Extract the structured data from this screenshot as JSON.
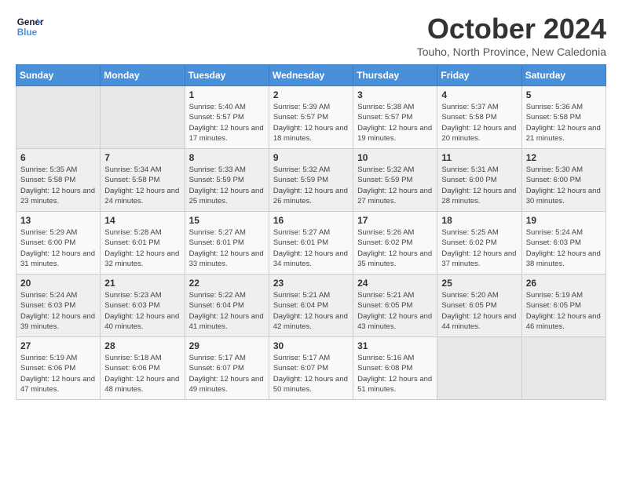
{
  "logo": {
    "line1": "General",
    "line2": "Blue"
  },
  "title": "October 2024",
  "subtitle": "Touho, North Province, New Caledonia",
  "days_header": [
    "Sunday",
    "Monday",
    "Tuesday",
    "Wednesday",
    "Thursday",
    "Friday",
    "Saturday"
  ],
  "weeks": [
    [
      {
        "num": "",
        "info": ""
      },
      {
        "num": "",
        "info": ""
      },
      {
        "num": "1",
        "info": "Sunrise: 5:40 AM\nSunset: 5:57 PM\nDaylight: 12 hours and 17 minutes."
      },
      {
        "num": "2",
        "info": "Sunrise: 5:39 AM\nSunset: 5:57 PM\nDaylight: 12 hours and 18 minutes."
      },
      {
        "num": "3",
        "info": "Sunrise: 5:38 AM\nSunset: 5:57 PM\nDaylight: 12 hours and 19 minutes."
      },
      {
        "num": "4",
        "info": "Sunrise: 5:37 AM\nSunset: 5:58 PM\nDaylight: 12 hours and 20 minutes."
      },
      {
        "num": "5",
        "info": "Sunrise: 5:36 AM\nSunset: 5:58 PM\nDaylight: 12 hours and 21 minutes."
      }
    ],
    [
      {
        "num": "6",
        "info": "Sunrise: 5:35 AM\nSunset: 5:58 PM\nDaylight: 12 hours and 23 minutes."
      },
      {
        "num": "7",
        "info": "Sunrise: 5:34 AM\nSunset: 5:58 PM\nDaylight: 12 hours and 24 minutes."
      },
      {
        "num": "8",
        "info": "Sunrise: 5:33 AM\nSunset: 5:59 PM\nDaylight: 12 hours and 25 minutes."
      },
      {
        "num": "9",
        "info": "Sunrise: 5:32 AM\nSunset: 5:59 PM\nDaylight: 12 hours and 26 minutes."
      },
      {
        "num": "10",
        "info": "Sunrise: 5:32 AM\nSunset: 5:59 PM\nDaylight: 12 hours and 27 minutes."
      },
      {
        "num": "11",
        "info": "Sunrise: 5:31 AM\nSunset: 6:00 PM\nDaylight: 12 hours and 28 minutes."
      },
      {
        "num": "12",
        "info": "Sunrise: 5:30 AM\nSunset: 6:00 PM\nDaylight: 12 hours and 30 minutes."
      }
    ],
    [
      {
        "num": "13",
        "info": "Sunrise: 5:29 AM\nSunset: 6:00 PM\nDaylight: 12 hours and 31 minutes."
      },
      {
        "num": "14",
        "info": "Sunrise: 5:28 AM\nSunset: 6:01 PM\nDaylight: 12 hours and 32 minutes."
      },
      {
        "num": "15",
        "info": "Sunrise: 5:27 AM\nSunset: 6:01 PM\nDaylight: 12 hours and 33 minutes."
      },
      {
        "num": "16",
        "info": "Sunrise: 5:27 AM\nSunset: 6:01 PM\nDaylight: 12 hours and 34 minutes."
      },
      {
        "num": "17",
        "info": "Sunrise: 5:26 AM\nSunset: 6:02 PM\nDaylight: 12 hours and 35 minutes."
      },
      {
        "num": "18",
        "info": "Sunrise: 5:25 AM\nSunset: 6:02 PM\nDaylight: 12 hours and 37 minutes."
      },
      {
        "num": "19",
        "info": "Sunrise: 5:24 AM\nSunset: 6:03 PM\nDaylight: 12 hours and 38 minutes."
      }
    ],
    [
      {
        "num": "20",
        "info": "Sunrise: 5:24 AM\nSunset: 6:03 PM\nDaylight: 12 hours and 39 minutes."
      },
      {
        "num": "21",
        "info": "Sunrise: 5:23 AM\nSunset: 6:03 PM\nDaylight: 12 hours and 40 minutes."
      },
      {
        "num": "22",
        "info": "Sunrise: 5:22 AM\nSunset: 6:04 PM\nDaylight: 12 hours and 41 minutes."
      },
      {
        "num": "23",
        "info": "Sunrise: 5:21 AM\nSunset: 6:04 PM\nDaylight: 12 hours and 42 minutes."
      },
      {
        "num": "24",
        "info": "Sunrise: 5:21 AM\nSunset: 6:05 PM\nDaylight: 12 hours and 43 minutes."
      },
      {
        "num": "25",
        "info": "Sunrise: 5:20 AM\nSunset: 6:05 PM\nDaylight: 12 hours and 44 minutes."
      },
      {
        "num": "26",
        "info": "Sunrise: 5:19 AM\nSunset: 6:05 PM\nDaylight: 12 hours and 46 minutes."
      }
    ],
    [
      {
        "num": "27",
        "info": "Sunrise: 5:19 AM\nSunset: 6:06 PM\nDaylight: 12 hours and 47 minutes."
      },
      {
        "num": "28",
        "info": "Sunrise: 5:18 AM\nSunset: 6:06 PM\nDaylight: 12 hours and 48 minutes."
      },
      {
        "num": "29",
        "info": "Sunrise: 5:17 AM\nSunset: 6:07 PM\nDaylight: 12 hours and 49 minutes."
      },
      {
        "num": "30",
        "info": "Sunrise: 5:17 AM\nSunset: 6:07 PM\nDaylight: 12 hours and 50 minutes."
      },
      {
        "num": "31",
        "info": "Sunrise: 5:16 AM\nSunset: 6:08 PM\nDaylight: 12 hours and 51 minutes."
      },
      {
        "num": "",
        "info": ""
      },
      {
        "num": "",
        "info": ""
      }
    ]
  ]
}
